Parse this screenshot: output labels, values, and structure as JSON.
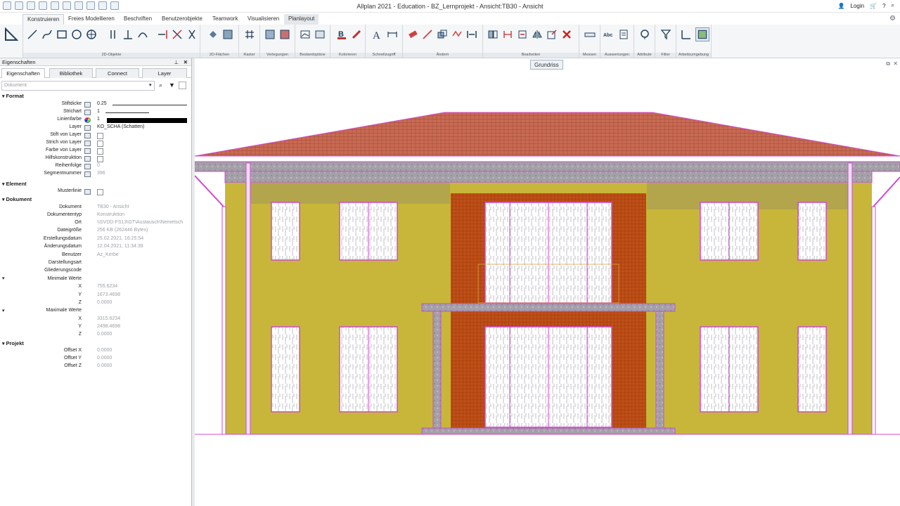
{
  "window": {
    "title": "Allplan 2021 - Education - BZ_Lernprojekt - Ansicht:TB30 - Ansicht",
    "login": "Login"
  },
  "tabs": [
    "Konstruieren",
    "Freies Modellieren",
    "Beschriften",
    "Benutzerobjekte",
    "Teamwork",
    "Visualisieren",
    "Planlayout"
  ],
  "ribbon_groups": [
    "2D-Objekte",
    "2D-Flächen",
    "Raster",
    "Verlegungen",
    "Bestandspläne",
    "Kolorieren",
    "Schnellzugriff",
    "Ändern",
    "Bearbeiten",
    "Messen",
    "Auswertungen",
    "Attribute",
    "Filter",
    "Arbeitsumgebung"
  ],
  "props": {
    "title": "Eigenschaften",
    "tabs": [
      "Eigenschaften",
      "Bibliothek",
      "Connect",
      "Layer"
    ],
    "filter_placeholder": "Dokument",
    "sections": {
      "format": "Format",
      "element": "Element",
      "dokument": "Dokument",
      "projekt": "Projekt"
    },
    "format": {
      "stiftdicke_k": "Stiftdicke",
      "stiftdicke_v": "0.25",
      "strichart_k": "Strichart",
      "strichart_v": "1",
      "linienfarbe_k": "Linienfarbe",
      "linienfarbe_v": "1",
      "layer_k": "Layer",
      "layer_v": "KO_SCHA (Schatten)",
      "stift_layer": "Stift von Layer",
      "strich_layer": "Strich von Layer",
      "farbe_layer": "Farbe von Layer",
      "hilfs": "Hilfskonstruktion",
      "reihen_k": "Reihenfolge",
      "reihen_v": "0",
      "segment_k": "Segmentnummer",
      "segment_v": "396"
    },
    "element": {
      "musterlinie": "Musterlinie"
    },
    "dokument": {
      "dokument_k": "Dokument",
      "dokument_v": "TB30 - Ansicht",
      "typ_k": "Dokumententyp",
      "typ_v": "Konstruktion",
      "ort_k": "Ort",
      "ort_v": "\\\\SVDD-FS13\\GT\\Austausch\\Nemetsch",
      "groesse_k": "Dateigröße",
      "groesse_v": "256 KB (262446 Bytes)",
      "erstell_k": "Erstellungsdatum",
      "erstell_v": "25.02.2021, 16:25:54",
      "aender_k": "Änderungsdatum",
      "aender_v": "12.04.2021, 11:34:39",
      "benutzer_k": "Benutzer",
      "benutzer_v": "Az_Kerbe",
      "darst": "Darstellungsart",
      "glied": "Gliederungscode",
      "min": "Minimale Werte",
      "min_x": "755.6234",
      "min_y": "1673.4698",
      "min_z": "0.0000",
      "max": "Maximale Werte",
      "max_x": "3315.6234",
      "max_y": "2498.4698",
      "max_z": "0.0000"
    },
    "projekt": {
      "ox_k": "Offset X",
      "ox_v": "0.0000",
      "oy_k": "Offset Y",
      "oy_v": "0.0000",
      "oz_k": "Offset Z",
      "oz_v": "0.0000"
    },
    "axis": {
      "x": "X",
      "y": "Y",
      "z": "Z"
    }
  },
  "canvas": {
    "view_label": "Grundriss"
  },
  "colors": {
    "roof": "#c96a52",
    "wall": "#c8b63a",
    "brick": "#b84a14",
    "frame": "#d04ad0",
    "stone": "#a4a0a8"
  }
}
